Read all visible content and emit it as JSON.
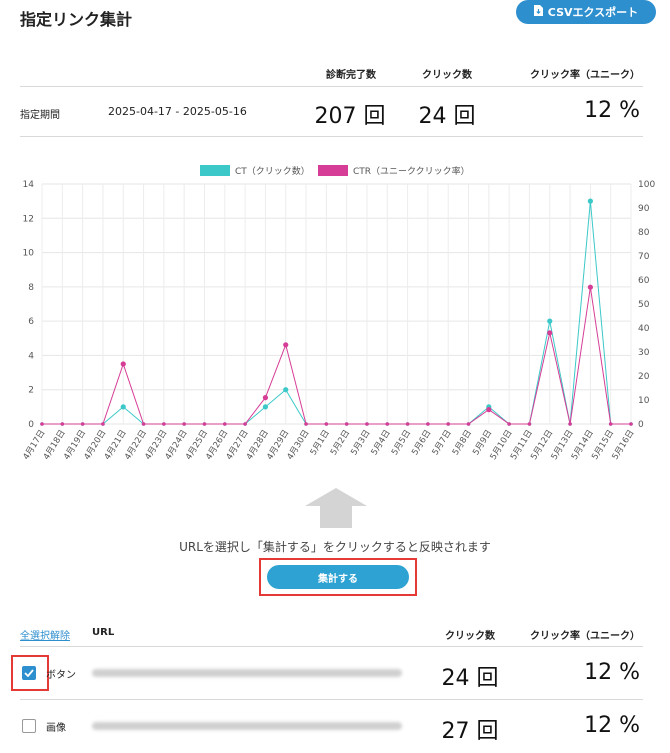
{
  "header": {
    "title": "指定リンク集計",
    "csv_button": "CSVエクスポート"
  },
  "summary": {
    "col_completed": "診断完了数",
    "col_clicks": "クリック数",
    "col_rate": "クリック率（ユニーク）",
    "period_label": "指定期間",
    "period_value": "2025-04-17 - 2025-05-16",
    "completed_value": "207 回",
    "clicks_value": "24 回",
    "rate_value": "12 %"
  },
  "chart_data": {
    "type": "line",
    "categories": [
      "4月17日",
      "4月18日",
      "4月19日",
      "4月20日",
      "4月21日",
      "4月22日",
      "4月23日",
      "4月24日",
      "4月25日",
      "4月26日",
      "4月27日",
      "4月28日",
      "4月29日",
      "4月30日",
      "5月1日",
      "5月2日",
      "5月3日",
      "5月4日",
      "5月5日",
      "5月6日",
      "5月7日",
      "5月8日",
      "5月9日",
      "5月10日",
      "5月11日",
      "5月12日",
      "5月13日",
      "5月14日",
      "5月15日",
      "5月16日"
    ],
    "series": [
      {
        "name": "CT（クリック数）",
        "color": "#3cc8c8",
        "axis": "left",
        "values": [
          0,
          0,
          0,
          0,
          1,
          0,
          0,
          0,
          0,
          0,
          0,
          1,
          2,
          0,
          0,
          0,
          0,
          0,
          0,
          0,
          0,
          0,
          1,
          0,
          0,
          6,
          0,
          13,
          0,
          0
        ]
      },
      {
        "name": "CTR（ユニーククリック率）",
        "color": "#d63d96",
        "axis": "right",
        "values": [
          0,
          0,
          0,
          0,
          25,
          0,
          0,
          0,
          0,
          0,
          0,
          11,
          33,
          0,
          0,
          0,
          0,
          0,
          0,
          0,
          0,
          0,
          6,
          0,
          0,
          38,
          0,
          57,
          0,
          0
        ]
      }
    ],
    "ylim_left": [
      0,
      14
    ],
    "yticks_left": [
      0,
      2,
      4,
      6,
      8,
      10,
      12,
      14
    ],
    "ylim_right": [
      0,
      100
    ],
    "yticks_right": [
      0,
      10,
      20,
      30,
      40,
      50,
      60,
      70,
      80,
      90,
      100
    ],
    "legend_position": "top-center",
    "grid": true
  },
  "instruction": {
    "text": "URLを選択し「集計する」をクリックすると反映されます",
    "button": "集計する"
  },
  "table": {
    "select_all": "全選択解除",
    "col_url": "URL",
    "col_clicks": "クリック数",
    "col_rate": "クリック率（ユニーク）",
    "rows": [
      {
        "checked": true,
        "label": "ボタン",
        "clicks": "24 回",
        "rate": "12 %"
      },
      {
        "checked": false,
        "label": "画像",
        "clicks": "27 回",
        "rate": "12 %"
      }
    ]
  }
}
